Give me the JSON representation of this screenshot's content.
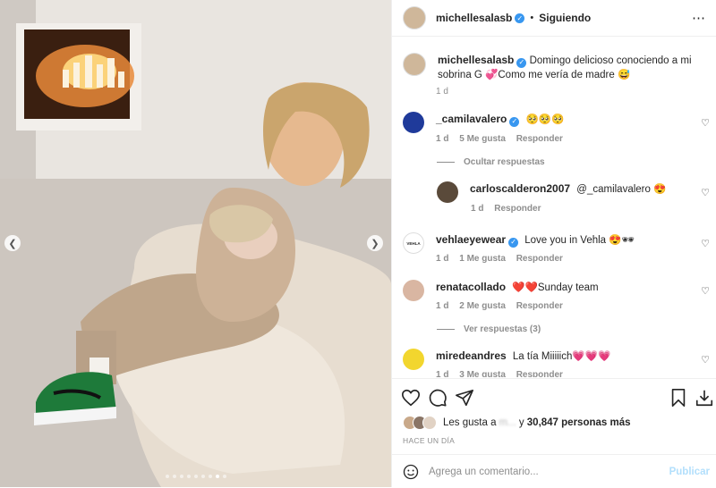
{
  "header": {
    "username": "michellesalasb",
    "separator": "•",
    "follow_status": "Siguiendo",
    "more_icon": "ellipsis-icon"
  },
  "caption": {
    "username": "michellesalasb",
    "text": "Domingo delicioso conociendo a mi sobrina G 💞Como me vería de madre 😅",
    "time": "1 d"
  },
  "comments": [
    {
      "username": "_camilavalero",
      "verified": true,
      "text": "🥺🥺🥺",
      "time": "1 d",
      "likes": "5 Me gusta",
      "reply": "Responder",
      "toggle": "Ocultar respuestas"
    },
    {
      "username": "carloscalderon2007",
      "text": "@_camilavalero 😍",
      "time": "1 d",
      "reply": "Responder"
    },
    {
      "username": "vehlaeyewear",
      "verified": true,
      "avatar_text": "VEHLA",
      "text": "Love you in Vehla 😍🕶",
      "time": "1 d",
      "likes": "1 Me gusta",
      "reply": "Responder"
    },
    {
      "username": "renatacollado",
      "text": "❤️❤️Sunday team",
      "time": "1 d",
      "likes": "2 Me gusta",
      "reply": "Responder",
      "toggle": "Ver respuestas (3)"
    },
    {
      "username": "miredeandres",
      "text": "La tía Miiiiich💗💗💗",
      "time": "1 d",
      "likes": "3 Me gusta",
      "reply": "Responder"
    }
  ],
  "likes_line": {
    "prefix": "Les gusta a",
    "hidden_name": "m...",
    "suffix": " y ",
    "count": "30,847 personas más"
  },
  "timestamp": "HACE UN DÍA",
  "add_comment": {
    "placeholder": "Agrega un comentario...",
    "post_label": "Publicar"
  },
  "carousel": {
    "total": 9,
    "active": 8
  },
  "colors": {
    "verified": "#3897f0",
    "muted": "#8e8e8e",
    "post_disabled": "#b2dffc"
  }
}
